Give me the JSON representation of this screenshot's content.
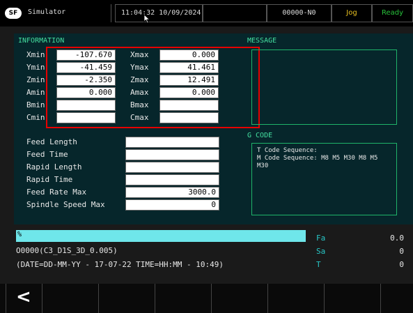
{
  "topbar": {
    "logo": "SF",
    "app_title": "Simulator",
    "datetime": "11:04:32 10/09/2024",
    "program_number": "00000-N0",
    "mode": "Jog",
    "status": "Ready"
  },
  "information": {
    "title": "INFORMATION",
    "rows": [
      {
        "min_label": "Xmin",
        "min_value": "-107.670",
        "max_label": "Xmax",
        "max_value": "0.000"
      },
      {
        "min_label": "Ymin",
        "min_value": "-41.459",
        "max_label": "Ymax",
        "max_value": "41.461"
      },
      {
        "min_label": "Zmin",
        "min_value": "-2.350",
        "max_label": "Zmax",
        "max_value": "12.491"
      },
      {
        "min_label": "Amin",
        "min_value": "0.000",
        "max_label": "Amax",
        "max_value": "0.000"
      },
      {
        "min_label": "Bmin",
        "min_value": "",
        "max_label": "Bmax",
        "max_value": ""
      },
      {
        "min_label": "Cmin",
        "min_value": "",
        "max_label": "Cmax",
        "max_value": ""
      }
    ],
    "feed": [
      {
        "label": "Feed Length",
        "value": ""
      },
      {
        "label": "Feed Time",
        "value": ""
      },
      {
        "label": "Rapid Length",
        "value": ""
      },
      {
        "label": "Rapid Time",
        "value": ""
      },
      {
        "label": "Feed Rate Max",
        "value": "3000.0"
      },
      {
        "label": "Spindle Speed Max",
        "value": "0"
      }
    ]
  },
  "message": {
    "title": "MESSAGE",
    "text": ""
  },
  "gcode": {
    "title": "G CODE",
    "line1": "T Code Sequence:",
    "line2": "M Code Sequence: M8 M5 M30 M8 M5",
    "line3": "M30"
  },
  "bottom": {
    "progress_label": "%",
    "program_line": "O0000(C3_D1S_3D_0.005)",
    "date_line": "(DATE=DD-MM-YY - 17-07-22 TIME=HH:MM - 10:49)",
    "status": [
      {
        "label": "Fa",
        "value": "0.0"
      },
      {
        "label": "Sa",
        "value": "0"
      },
      {
        "label": "T",
        "value": "0"
      }
    ]
  },
  "softkeys": {
    "back": "<"
  }
}
